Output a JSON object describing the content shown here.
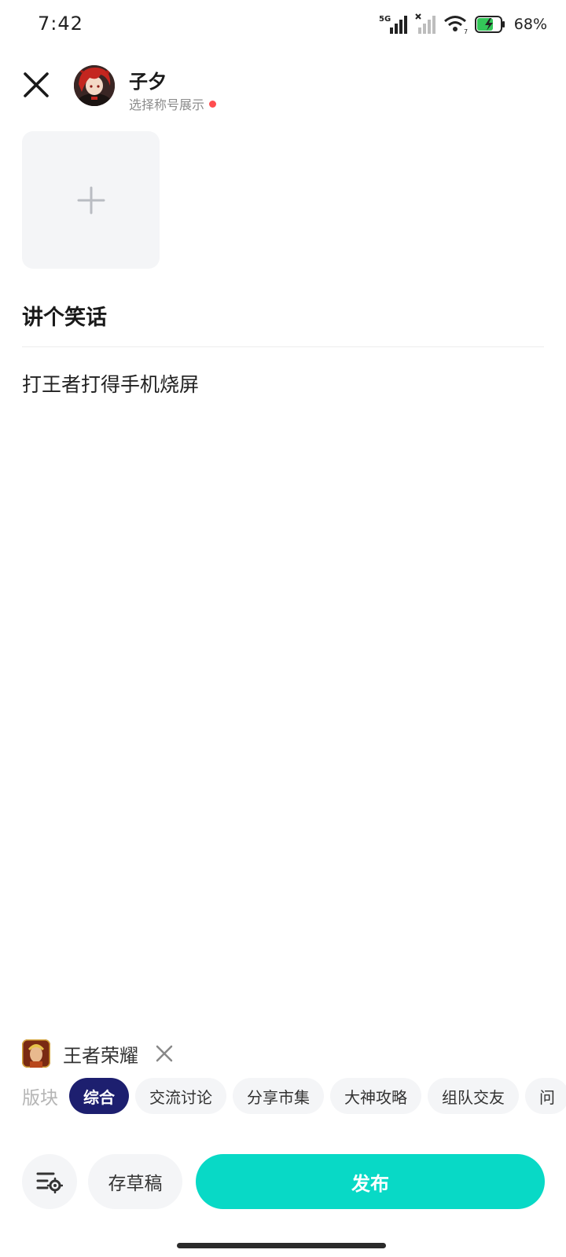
{
  "status_bar": {
    "time": "7:42",
    "network_label": "5G",
    "battery_percent": "68%"
  },
  "header": {
    "close_icon": "close-icon",
    "username": "子夕",
    "title_select": "选择称号展示"
  },
  "editor": {
    "add_image_icon": "plus-icon",
    "title": "讲个笑话",
    "body": "打王者打得手机烧屏"
  },
  "game": {
    "name": "王者荣耀"
  },
  "sections": {
    "label": "版块",
    "chips": [
      "综合",
      "交流讨论",
      "分享市集",
      "大神攻略",
      "组队交友",
      "问"
    ],
    "active_index": 0
  },
  "actions": {
    "settings_icon": "list-settings-icon",
    "draft": "存草稿",
    "publish": "发布"
  },
  "colors": {
    "accent": "#08d9c6",
    "active_chip": "#1d1f6f",
    "red_dot": "#ff4d4f"
  }
}
